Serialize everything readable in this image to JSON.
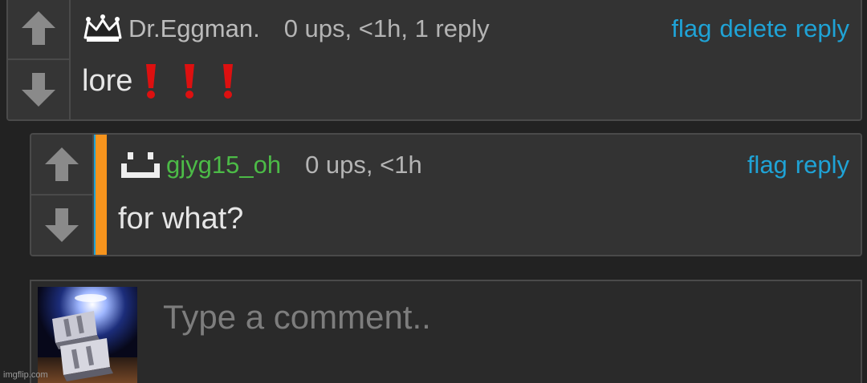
{
  "comments": [
    {
      "username": "Dr.Eggman.",
      "stats": "0 ups, <1h, 1 reply",
      "text": "lore",
      "actions": {
        "flag": "flag",
        "delete": "delete",
        "reply": "reply"
      },
      "badge_icon": "crown-icon",
      "emoji_icon": "red-exclamation-icon",
      "emoji_count": 3
    },
    {
      "username": "gjyg15_oh",
      "stats": "0 ups, <1h",
      "text": "for what?",
      "actions": {
        "flag": "flag",
        "reply": "reply"
      },
      "badge_icon": "smile-face-icon",
      "username_color": "#4cbb47"
    }
  ],
  "composer": {
    "placeholder": "Type a comment..",
    "avatar_icon": "user-avatar-image"
  },
  "watermark": "imgflip.com",
  "colors": {
    "background": "#222222",
    "card": "#333333",
    "border": "#4a4a4a",
    "link": "#1fa3d6",
    "reply_accent": "#f7941d",
    "text": "#e6e6e6",
    "muted": "#b4b4b4",
    "exclaim": "#dd1010"
  }
}
